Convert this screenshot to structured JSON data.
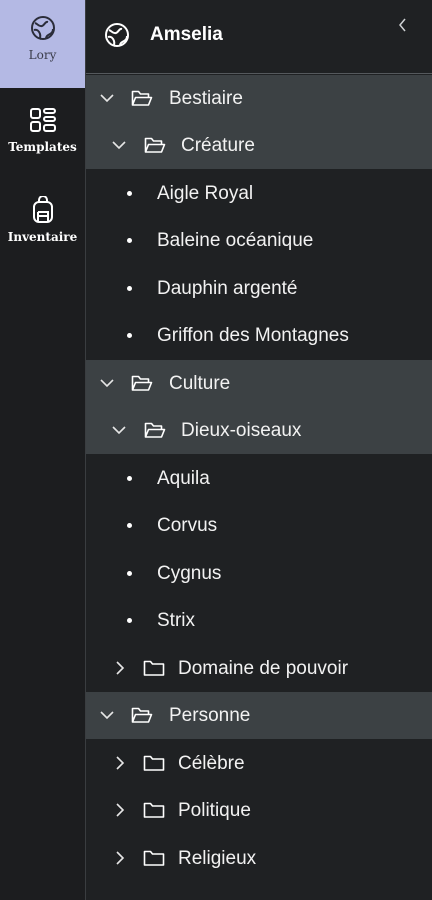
{
  "rail": {
    "items": [
      {
        "label": "Lory",
        "icon": "globe-icon",
        "active": true
      },
      {
        "label": "Templates",
        "icon": "grid-icon",
        "active": false
      },
      {
        "label": "Inventaire",
        "icon": "backpack-icon",
        "active": false
      }
    ]
  },
  "header": {
    "title": "Amselia",
    "icon": "globe-icon",
    "collapse_icon": "chevron-left-icon"
  },
  "tree": {
    "bestiaire": "Bestiaire",
    "creature": "Créature",
    "creature_items": [
      "Aigle Royal",
      "Baleine océanique",
      "Dauphin argenté",
      "Griffon des Montagnes"
    ],
    "culture": "Culture",
    "dieux": "Dieux-oiseaux",
    "dieux_items": [
      "Aquila",
      "Corvus",
      "Cygnus",
      "Strix"
    ],
    "domaine": "Domaine de pouvoir",
    "personne": "Personne",
    "personne_children": [
      "Célèbre",
      "Politique",
      "Religieux"
    ]
  },
  "colors": {
    "rail_bg": "#1c1d1f",
    "rail_active": "#b4b9e4",
    "panel_bg": "#1f2123",
    "open_row_bg": "#3c4144"
  }
}
